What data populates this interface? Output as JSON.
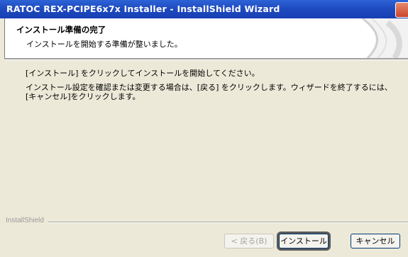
{
  "window": {
    "title": "RATOC REX-PCIPE6x7x Installer - InstallShield Wizard"
  },
  "header": {
    "title": "インストール準備の完了",
    "subtitle": "インストールを開始する準備が整いました。"
  },
  "content": {
    "line1": "[インストール] をクリックしてインストールを開始してください。",
    "line2": "インストール設定を確認または変更する場合は、[戻る] をクリックします。ウィザードを終了するには、[キャンセル]をクリックします。"
  },
  "footer": {
    "brand": "InstallShield",
    "back_label": "< 戻る(B)",
    "install_label": "インストール",
    "cancel_label": "キャンセル"
  }
}
